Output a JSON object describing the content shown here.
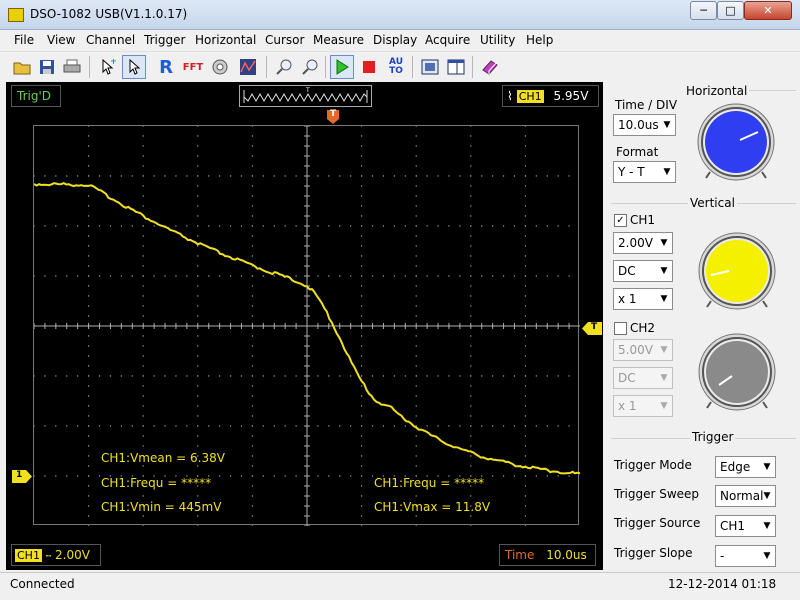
{
  "window": {
    "title": "DSO-1082 USB(V1.1.0.17)"
  },
  "menu": [
    "File",
    "View",
    "Channel",
    "Trigger",
    "Horizontal",
    "Cursor",
    "Measure",
    "Display",
    "Acquire",
    "Utility",
    "Help"
  ],
  "toolbar": {
    "auto_label": "AU\nTO",
    "icons": [
      "open-icon",
      "save-icon",
      "print-icon",
      "cursor-cross-icon",
      "pointer-icon",
      "ref-icon",
      "fft-icon",
      "math-icon",
      "waveform-icon",
      "zoom-in-icon",
      "zoom-out-icon",
      "run-icon",
      "stop-icon",
      "auto-icon",
      "fit-icon",
      "window-icon",
      "book-icon"
    ]
  },
  "scope": {
    "trig_status": "Trig'D",
    "trig_channel": "CH1",
    "trig_level": "5.95V",
    "ch1_scale_channel": "CH1",
    "ch1_scale_value": "2.00V",
    "time_label": "Time",
    "time_value": "10.0us",
    "trigger_marker": "T",
    "ch1_marker": "1",
    "measurements": {
      "vmean": "CH1:Vmean = 6.38V",
      "frequ_left": "CH1:Frequ = *****",
      "vmin": "CH1:Vmin = 445mV",
      "frequ_right": "CH1:Frequ = *****",
      "vmax": "CH1:Vmax = 11.8V"
    }
  },
  "panel": {
    "horizontal": {
      "title": "Horizontal",
      "time_div_label": "Time / DIV",
      "time_div_value": "10.0us",
      "format_label": "Format",
      "format_value": "Y - T"
    },
    "vertical": {
      "title": "Vertical",
      "ch1_label": "CH1",
      "ch1_checked": true,
      "ch1_volts": "2.00V",
      "ch1_coupling": "DC",
      "ch1_probe": "x 1",
      "ch2_label": "CH2",
      "ch2_checked": false,
      "ch2_volts": "5.00V",
      "ch2_coupling": "DC",
      "ch2_probe": "x 1"
    },
    "trigger": {
      "title": "Trigger",
      "mode_label": "Trigger Mode",
      "mode_value": "Edge",
      "sweep_label": "Trigger Sweep",
      "sweep_value": "Normal",
      "source_label": "Trigger Source",
      "source_value": "CH1",
      "slope_label": "Trigger Slope",
      "slope_value": "-"
    }
  },
  "status": {
    "left": "Connected",
    "datetime": "12-12-2014  01:18"
  },
  "colors": {
    "trace": "#f0e020",
    "grid_bg": "#000000",
    "knob_h": "#2f3ef0",
    "knob_ch1": "#f5f000",
    "knob_ch2": "#8a8a8a"
  }
}
